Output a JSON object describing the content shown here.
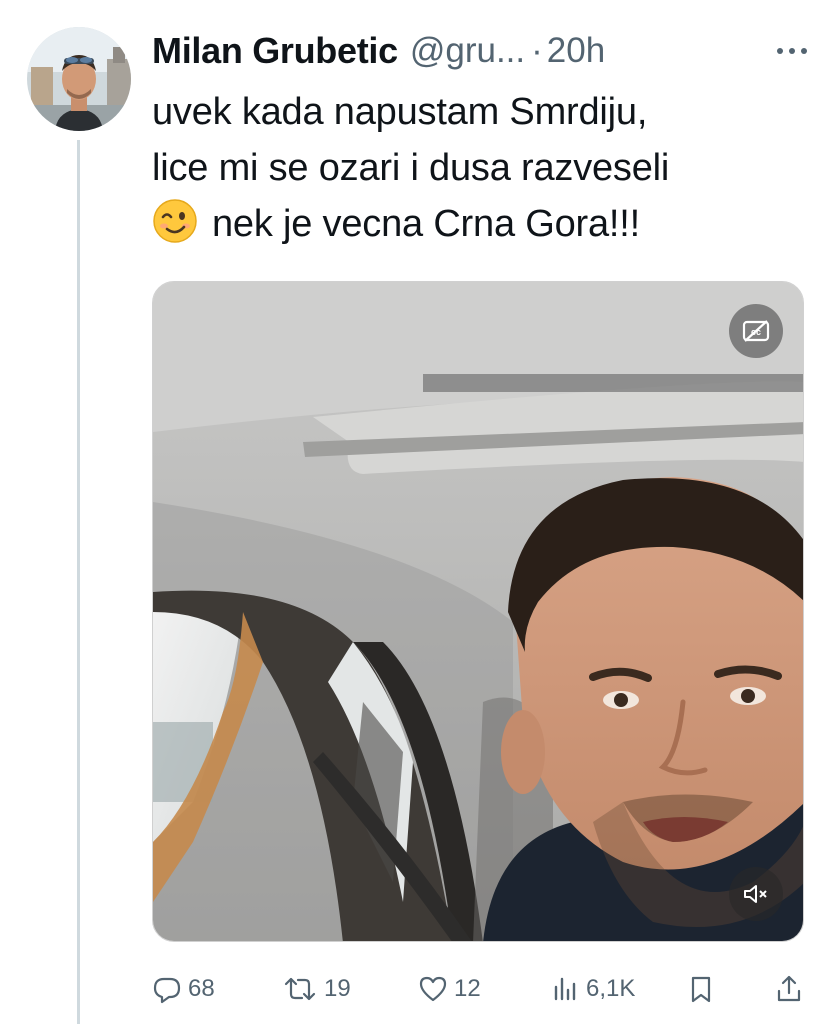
{
  "tweet": {
    "author_name": "Milan Grubetic",
    "handle": "@gru...",
    "separator": "·",
    "time": "20h",
    "lines": [
      "uvek kada napustam Smrdiju,",
      "lice mi se ozari i dusa razveseli",
      "nek je vecna Crna Gora!!!"
    ],
    "emoji": "winking-face"
  },
  "media": {
    "cc_icon": "captions-off-icon",
    "mute_icon": "volume-muted-icon"
  },
  "actions": {
    "replies": "68",
    "retweets": "19",
    "likes": "12",
    "views": "6,1K"
  },
  "colors": {
    "text": "#0f1419",
    "secondary": "#536471",
    "thread_line": "#cfd9de"
  }
}
